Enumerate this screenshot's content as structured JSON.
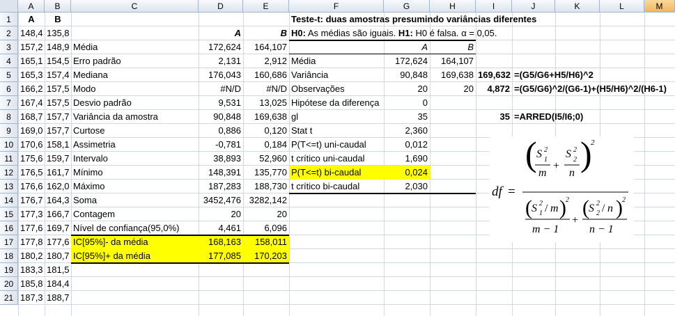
{
  "column_headers": [
    "A",
    "B",
    "C",
    "D",
    "E",
    "F",
    "G",
    "H",
    "I",
    "J",
    "K",
    "L",
    "M"
  ],
  "row_headers": [
    "1",
    "2",
    "3",
    "4",
    "5",
    "6",
    "7",
    "8",
    "9",
    "10",
    "11",
    "12",
    "13",
    "14",
    "15",
    "16",
    "17",
    "18",
    "19",
    "20",
    "21"
  ],
  "col_a": [
    "A",
    "148,4",
    "157,2",
    "165,1",
    "165,3",
    "166,2",
    "167,4",
    "168,7",
    "169,0",
    "170,6",
    "175,6",
    "176,5",
    "176,6",
    "176,7",
    "177,3",
    "177,6",
    "177,8",
    "180,2",
    "183,3",
    "185,8",
    "187,3"
  ],
  "col_b": [
    "B",
    "135,8",
    "148,9",
    "154,5",
    "157,4",
    "157,5",
    "157,5",
    "157,7",
    "157,7",
    "158,1",
    "159,7",
    "161,7",
    "162,0",
    "164,3",
    "166,7",
    "169,7",
    "177,6",
    "180,7",
    "181,5",
    "184,4",
    "188,7"
  ],
  "descriptive": {
    "header_a": "A",
    "header_b": "B",
    "rows": [
      {
        "label": "Média",
        "a": "172,624",
        "b": "164,107"
      },
      {
        "label": "Erro padrão",
        "a": "2,131",
        "b": "2,912"
      },
      {
        "label": "Mediana",
        "a": "176,043",
        "b": "160,686"
      },
      {
        "label": "Modo",
        "a": "#N/D",
        "b": "#N/D"
      },
      {
        "label": "Desvio padrão",
        "a": "9,531",
        "b": "13,025"
      },
      {
        "label": "Variância da amostra",
        "a": "90,848",
        "b": "169,638"
      },
      {
        "label": "Curtose",
        "a": "0,886",
        "b": "0,120"
      },
      {
        "label": "Assimetria",
        "a": "-0,781",
        "b": "0,184"
      },
      {
        "label": "Intervalo",
        "a": "38,893",
        "b": "52,960"
      },
      {
        "label": "Mínimo",
        "a": "148,391",
        "b": "135,770"
      },
      {
        "label": "Máximo",
        "a": "187,283",
        "b": "188,730"
      },
      {
        "label": "Soma",
        "a": "3452,476",
        "b": "3282,142"
      },
      {
        "label": "Contagem",
        "a": "20",
        "b": "20"
      },
      {
        "label": "Nível de confiança(95,0%)",
        "a": "4,461",
        "b": "6,096"
      },
      {
        "label": "IC[95%]- da média",
        "a": "168,163",
        "b": "158,011"
      },
      {
        "label": "IC[95%]+ da média",
        "a": "177,085",
        "b": "170,203"
      }
    ]
  },
  "ttest": {
    "title": "Teste-t: duas amostras presumindo variâncias diferentes",
    "h0_bold": "H0:",
    "h0_text": " As médias são iguais. ",
    "h1_bold": "H1:",
    "h1_text": " H0 é falsa. α = 0,05.",
    "header_a": "A",
    "header_b": "B",
    "rows": [
      {
        "label": "Média",
        "a": "172,624",
        "b": "164,107"
      },
      {
        "label": "Variância",
        "a": "90,848",
        "b": "169,638"
      },
      {
        "label": "Observações",
        "a": "20",
        "b": "20"
      },
      {
        "label": "Hipótese da diferença",
        "a": "0",
        "b": ""
      },
      {
        "label": "gl",
        "a": "35",
        "b": ""
      },
      {
        "label": "Stat t",
        "a": "2,360",
        "b": ""
      },
      {
        "label": "P(T<=t) uni-caudal",
        "a": "0,012",
        "b": ""
      },
      {
        "label": "t crítico uni-caudal",
        "a": "1,690",
        "b": ""
      },
      {
        "label": "P(T<=t) bi-caudal",
        "a": "0,024",
        "b": ""
      },
      {
        "label": "t crítico bi-caudal",
        "a": "2,030",
        "b": ""
      }
    ]
  },
  "calc": {
    "i5": "169,632",
    "j5": "=(G5/G6+H5/H6)^2",
    "i6": "4,872",
    "j6": "=(G5/G6)^2/(G6-1)+(H5/H6)^2/(H6-1)",
    "i8": "35",
    "j8": "=ARRED(I5/I6;0)"
  },
  "formula": {
    "df": "df",
    "eq": "=",
    "s": "S",
    "sub1": "1",
    "sub2": "2",
    "sq": "2",
    "m": "m",
    "n": "n",
    "plus": "+",
    "slash": "/",
    "m_minus_1": "m − 1",
    "n_minus_1": "n − 1"
  },
  "colors": {
    "highlight": "#ffff00",
    "header_selected": "#f2b65c",
    "grid": "#d0d7e5"
  }
}
